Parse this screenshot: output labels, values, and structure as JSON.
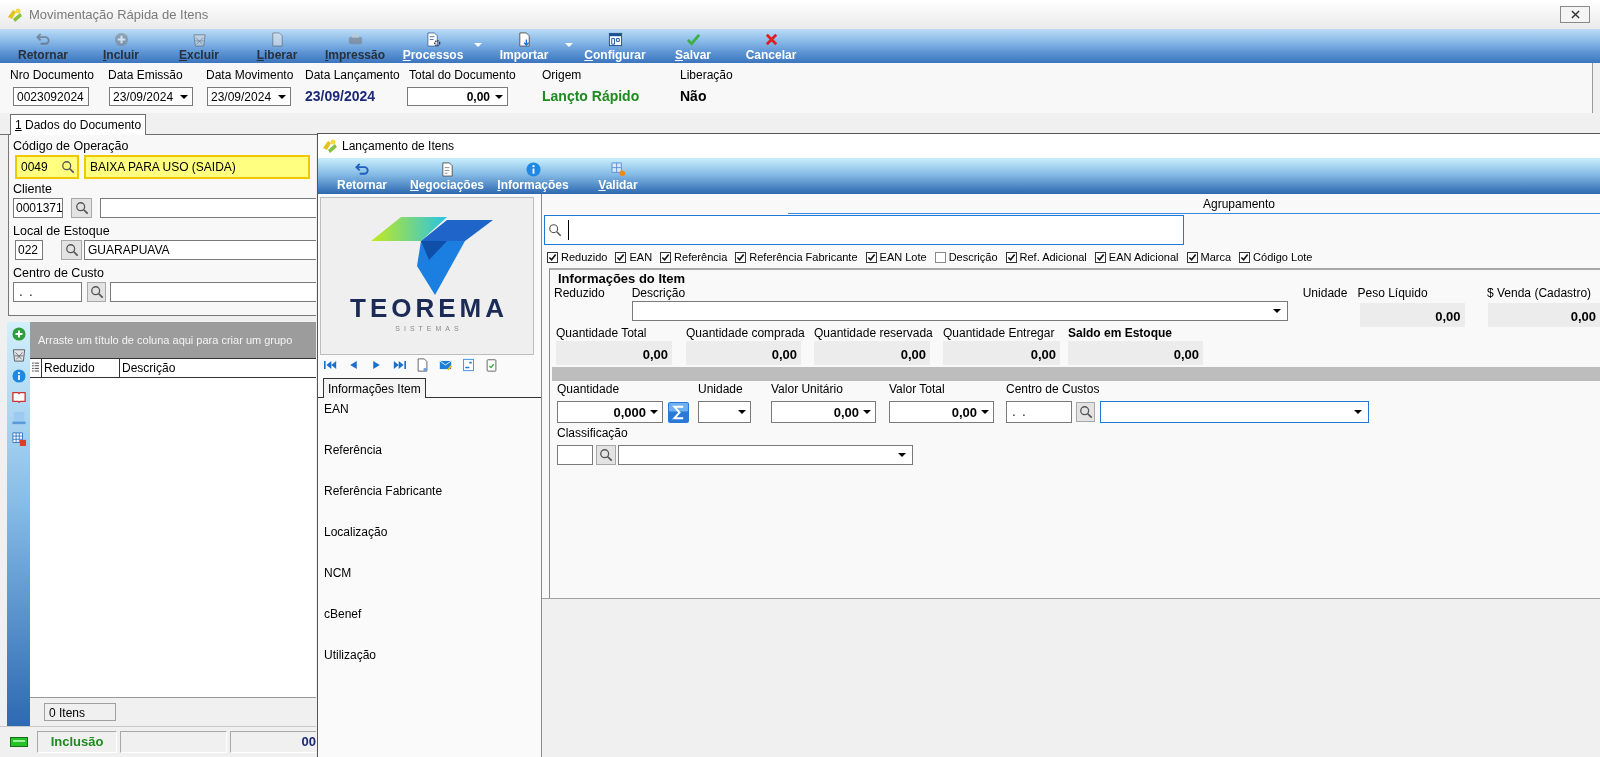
{
  "window": {
    "title": "Movimentação Rápida de Itens",
    "active": false
  },
  "toolbar": [
    {
      "label": "Retornar",
      "disabled": true,
      "mnemonic": false,
      "menu": false
    },
    {
      "label": "Incluir",
      "disabled": true,
      "mnemonic": true,
      "menu": false
    },
    {
      "label": "Excluir",
      "disabled": true,
      "mnemonic": true,
      "menu": false
    },
    {
      "label": "Liberar",
      "disabled": true,
      "mnemonic": true,
      "menu": false
    },
    {
      "label": "Impressão",
      "disabled": true,
      "mnemonic": true,
      "menu": false
    },
    {
      "label": "Processos",
      "disabled": false,
      "mnemonic": true,
      "menu": true
    },
    {
      "label": "Importar",
      "disabled": false,
      "mnemonic": false,
      "menu": true
    },
    {
      "label": "Configurar",
      "disabled": false,
      "mnemonic": true,
      "menu": false
    },
    {
      "label": "Salvar",
      "disabled": false,
      "mnemonic": true,
      "menu": false
    },
    {
      "label": "Cancelar",
      "disabled": false,
      "mnemonic": false,
      "menu": false
    }
  ],
  "header": [
    {
      "label": "Nro Documento",
      "kind": "text",
      "value": "0023092024"
    },
    {
      "label": "Data Emissão",
      "kind": "date",
      "value": "23/09/2024"
    },
    {
      "label": "Data Movimento",
      "kind": "date",
      "value": "23/09/2024"
    },
    {
      "label": "Data Lançamento",
      "kind": "display",
      "value": "23/09/2024",
      "color": "#1c2878"
    },
    {
      "label": "Total do Documento",
      "kind": "amount",
      "value": "0,00"
    },
    {
      "label": "Origem",
      "kind": "display",
      "value": "Lançto Rápido",
      "color": "#1f8a1f"
    },
    {
      "label": "Liberação",
      "kind": "display",
      "value": "Não",
      "color": "#000000"
    }
  ],
  "tabs": [
    {
      "label": "1 Dados do Documento",
      "selected": true,
      "mnemonic": true
    }
  ],
  "document_fields": [
    {
      "label": "Código de Operação",
      "kind": "inline",
      "code": "0049",
      "description": "BAIXA PARA USO (SAIDA)",
      "highlighted": true
    },
    {
      "label": "Cliente",
      "kind": "lookup",
      "code": "0001371",
      "highlighted": false
    },
    {
      "label": "Local de Estoque",
      "kind": "lookup",
      "code": "022",
      "description": "GUARAPUAVA",
      "highlighted": false
    },
    {
      "label": "Centro de Custo",
      "kind": "lookup",
      "code": " .  .",
      "highlighted": false
    }
  ],
  "grid": {
    "group_hint": "Arraste um título de coluna aqui para criar um grupo",
    "columns": [
      "Reduzido",
      "Descrição"
    ],
    "footer": "0 Itens"
  },
  "status_bar": {
    "mode": "Inclusão",
    "total": "00"
  },
  "dialog": {
    "title": "Lançamento de Itens",
    "active": true,
    "toolbar": [
      {
        "label": "Retornar",
        "mnemonic": false
      },
      {
        "label": "Negociações",
        "mnemonic": true
      },
      {
        "label": "Informações",
        "mnemonic": true
      },
      {
        "label": "Validar",
        "mnemonic": true
      }
    ],
    "logo": {
      "name": "TEOREMA",
      "tagline": "SISTEMAS"
    },
    "info_tab": {
      "label": "Informações Item",
      "selected": true
    },
    "info_fields": [
      "EAN",
      "Referência",
      "Referência Fabricante",
      "Localização",
      "NCM",
      "cBenef",
      "Utilização"
    ],
    "search": {
      "label": "Agrupamento"
    },
    "search_options": [
      {
        "label": "Reduzido",
        "checked": true
      },
      {
        "label": "EAN",
        "checked": true
      },
      {
        "label": "Referência",
        "checked": true
      },
      {
        "label": "Referência Fabricante",
        "checked": true
      },
      {
        "label": "EAN Lote",
        "checked": true
      },
      {
        "label": "Descrição",
        "checked": false
      },
      {
        "label": "Ref. Adicional",
        "checked": true
      },
      {
        "label": "EAN Adicional",
        "checked": true
      },
      {
        "label": "Marca",
        "checked": true
      },
      {
        "label": "Código Lote",
        "checked": true
      }
    ],
    "item_info": {
      "title": "Informações do Item",
      "code_label": "Reduzido",
      "description_label": "Descrição",
      "unit_label": "Unidade",
      "weight": {
        "label": "Peso Líquido",
        "value": "0,00"
      },
      "sale_price": {
        "label": "$ Venda (Cadastro)",
        "value": "0,00"
      },
      "quantities": [
        {
          "label": "Quantidade Total",
          "value": "0,00",
          "emphasis": false
        },
        {
          "label": "Quantidade comprada",
          "value": "0,00",
          "emphasis": false
        },
        {
          "label": "Quantidade reservada",
          "value": "0,00",
          "emphasis": false
        },
        {
          "label": "Quantidade Entregar",
          "value": "0,00",
          "emphasis": false
        },
        {
          "label": "Saldo em Estoque",
          "value": "0,00",
          "emphasis": true
        }
      ]
    },
    "entry": {
      "quantity": {
        "label": "Quantidade",
        "value": "0,000"
      },
      "unit": {
        "label": "Unidade"
      },
      "unit_price": {
        "label": "Valor Unitário",
        "value": "0,00"
      },
      "total": {
        "label": "Valor Total",
        "value": "0,00"
      },
      "cost_center": {
        "label": "Centro de Custos",
        "code": " .  ."
      },
      "classification": {
        "label": "Classificação"
      }
    }
  }
}
